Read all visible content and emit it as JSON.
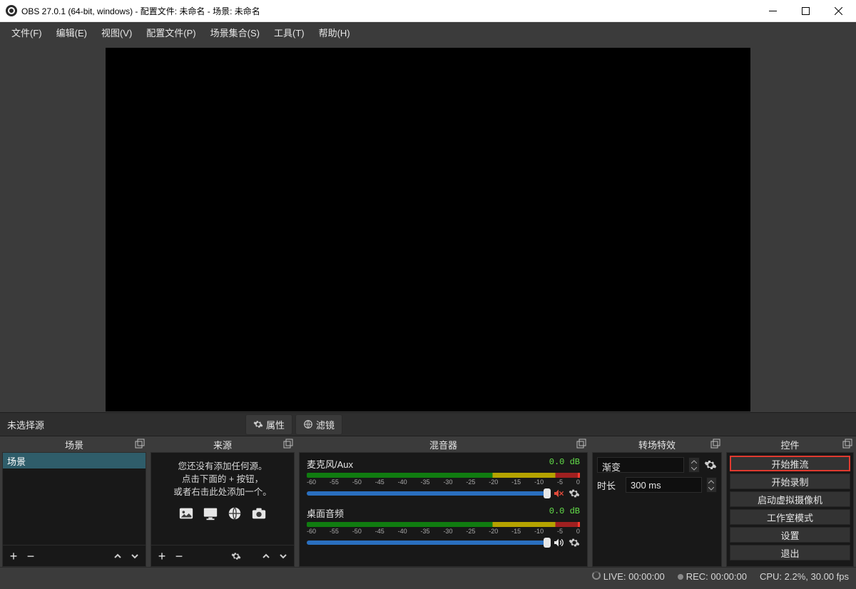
{
  "titlebar": {
    "title": "OBS 27.0.1 (64-bit, windows) - 配置文件: 未命名 - 场景: 未命名"
  },
  "menu": {
    "file": "文件(F)",
    "edit": "编辑(E)",
    "view": "视图(V)",
    "profile": "配置文件(P)",
    "scene_col": "场景集合(S)",
    "tools": "工具(T)",
    "help": "帮助(H)"
  },
  "sourcebar": {
    "none_selected": "未选择源",
    "properties": "属性",
    "filters": "滤镜"
  },
  "panels": {
    "scene": {
      "title": "场景",
      "items": [
        "场景"
      ]
    },
    "source": {
      "title": "来源",
      "empty1": "您还没有添加任何源。",
      "empty2": "点击下面的 + 按钮，",
      "empty3": "或者右击此处添加一个。"
    },
    "mixer": {
      "title": "混音器",
      "ch": [
        {
          "name": "麦克风/Aux",
          "db": "0.0 dB",
          "fill": 100,
          "muted": true
        },
        {
          "name": "桌面音频",
          "db": "0.0 dB",
          "fill": 100,
          "muted": false
        }
      ],
      "ticks": [
        "-60",
        "-55",
        "-50",
        "-45",
        "-40",
        "-35",
        "-30",
        "-25",
        "-20",
        "-15",
        "-10",
        "-5",
        "0"
      ]
    },
    "transitions": {
      "title": "转场特效",
      "selected": "渐变",
      "duration_label": "时长",
      "duration_value": "300 ms"
    },
    "controls": {
      "title": "控件",
      "buttons": {
        "stream": "开始推流",
        "record": "开始录制",
        "vcam": "启动虚拟摄像机",
        "studio": "工作室模式",
        "settings": "设置",
        "exit": "退出"
      }
    }
  },
  "status": {
    "live": "LIVE: 00:00:00",
    "rec": "REC: 00:00:00",
    "cpu": "CPU: 2.2%, 30.00 fps"
  }
}
